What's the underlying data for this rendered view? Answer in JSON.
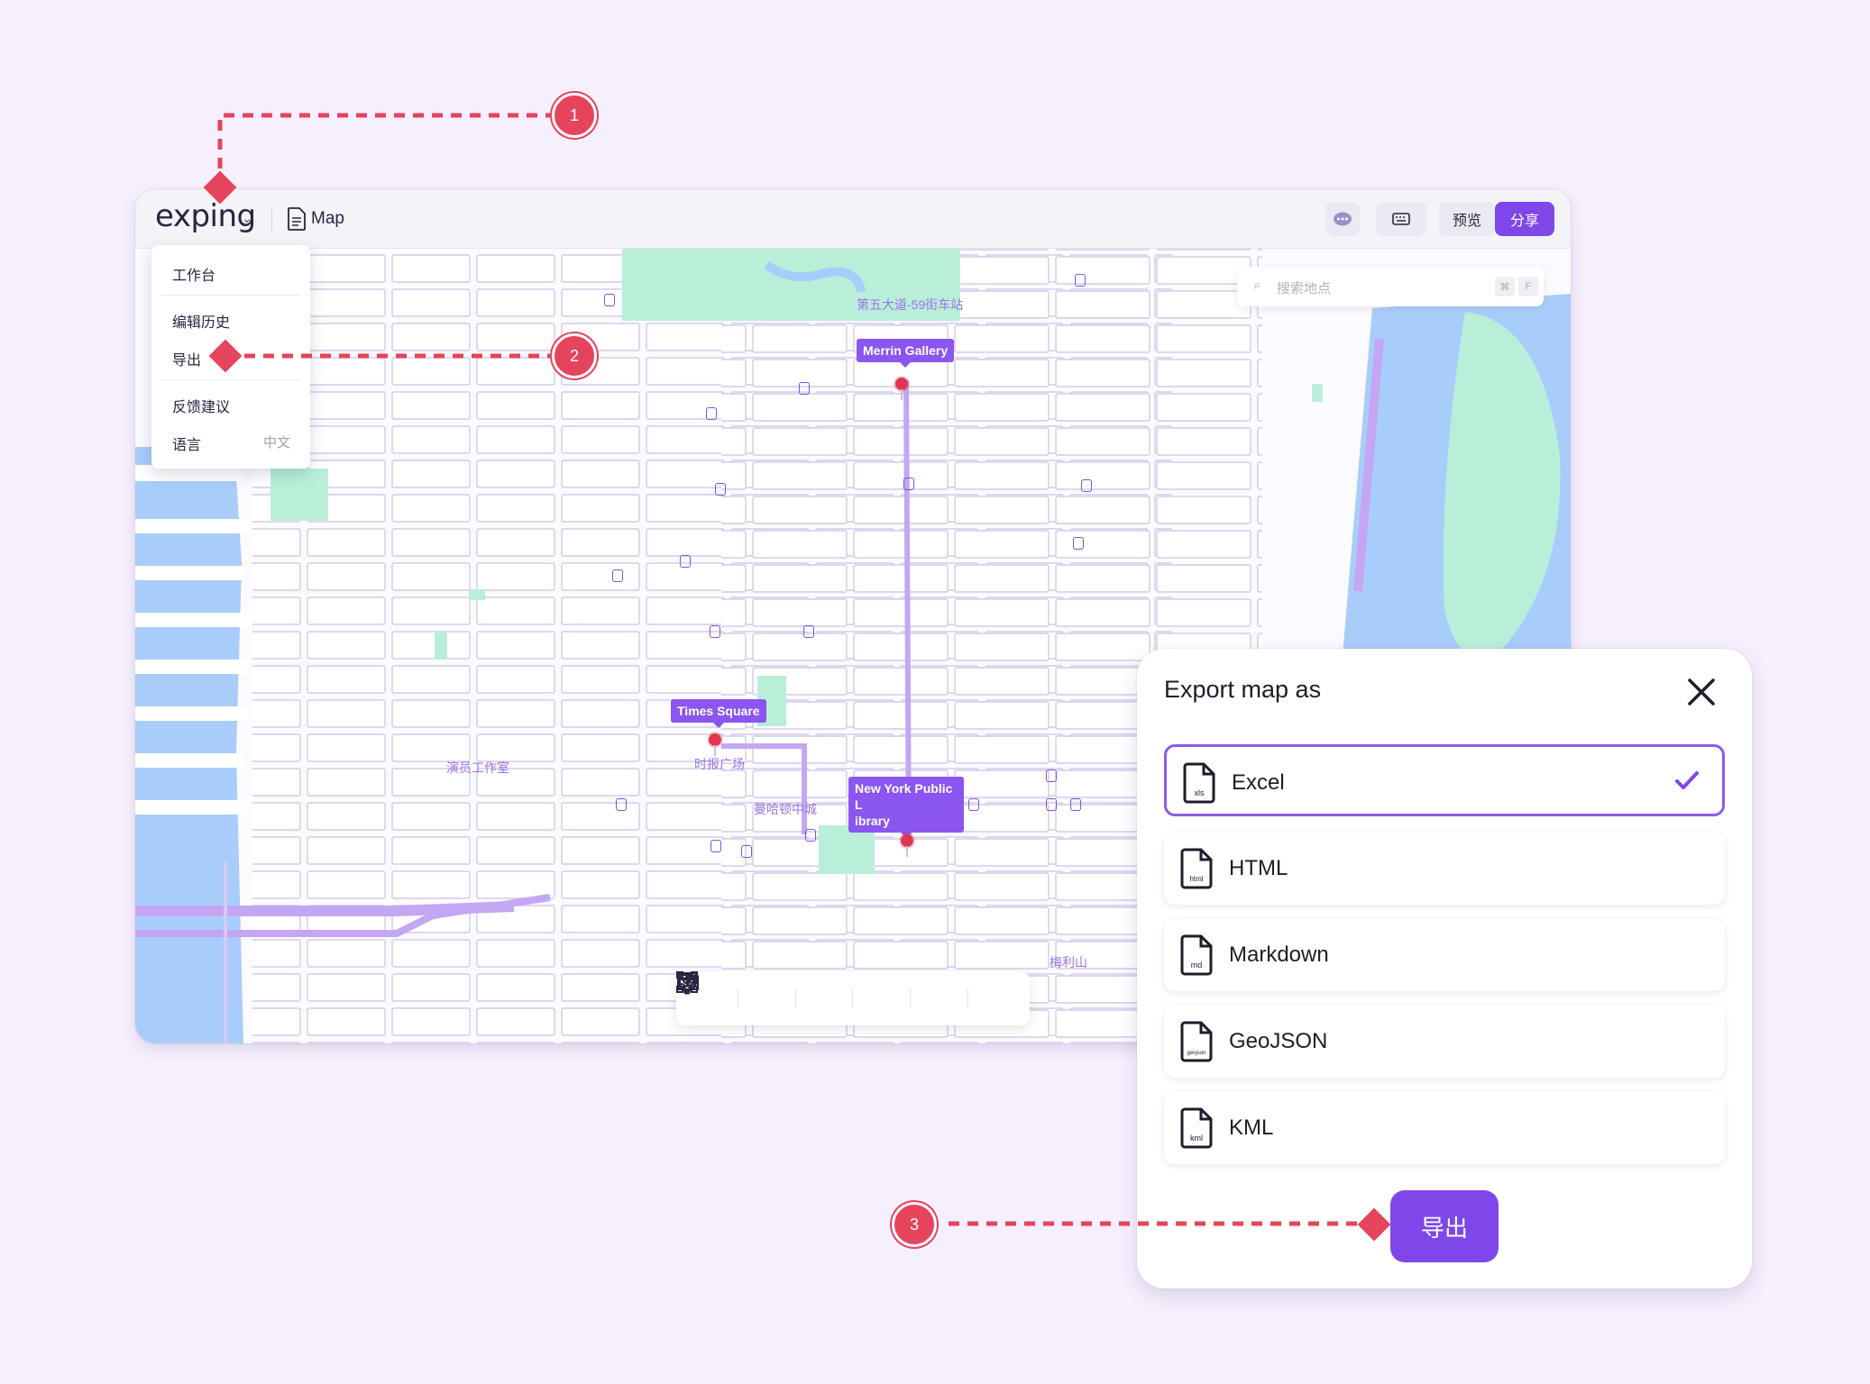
{
  "app": {
    "logo": "exping",
    "doc_title": "Map",
    "buttons": {
      "preview": "预览",
      "share": "分享"
    }
  },
  "menu": {
    "workspace": "工作台",
    "history": "编辑历史",
    "export": "导出",
    "feedback": "反馈建议",
    "language": "语言",
    "language_value": "中文"
  },
  "map": {
    "search_placeholder": "搜索地点",
    "search_kbd_1": "⌘",
    "search_kbd_2": "F",
    "pins": [
      {
        "label": "Merrin Gallery"
      },
      {
        "label": "Times Square"
      },
      {
        "label": "New York Public L\nibrary"
      }
    ],
    "place_labels": {
      "station": "第五大道-59街车站",
      "times_square": "时报广场",
      "studio": "演员工作室",
      "midtown": "曼哈顿中城",
      "murray_hill": "梅利山"
    },
    "tools": [
      "location-pin-tool",
      "route-tool",
      "area-tool",
      "emoji-tool",
      "import-tool",
      "style-tool"
    ]
  },
  "export_panel": {
    "title": "Export map as",
    "options": [
      {
        "name": "Excel",
        "ext": "xls",
        "selected": true
      },
      {
        "name": "HTML",
        "ext": "html",
        "selected": false
      },
      {
        "name": "Markdown",
        "ext": "md",
        "selected": false
      },
      {
        "name": "GeoJSON",
        "ext": "geojson",
        "selected": false
      },
      {
        "name": "KML",
        "ext": "kml",
        "selected": false
      }
    ],
    "export_button": "导出"
  },
  "annotations": {
    "step1": "1",
    "step2": "2",
    "step3": "3"
  },
  "colors": {
    "accent": "#7f46ea",
    "annotation": "#e6435d",
    "water": "#a9cdfa",
    "park": "#b9efd9",
    "route": "#c4a6f3"
  }
}
